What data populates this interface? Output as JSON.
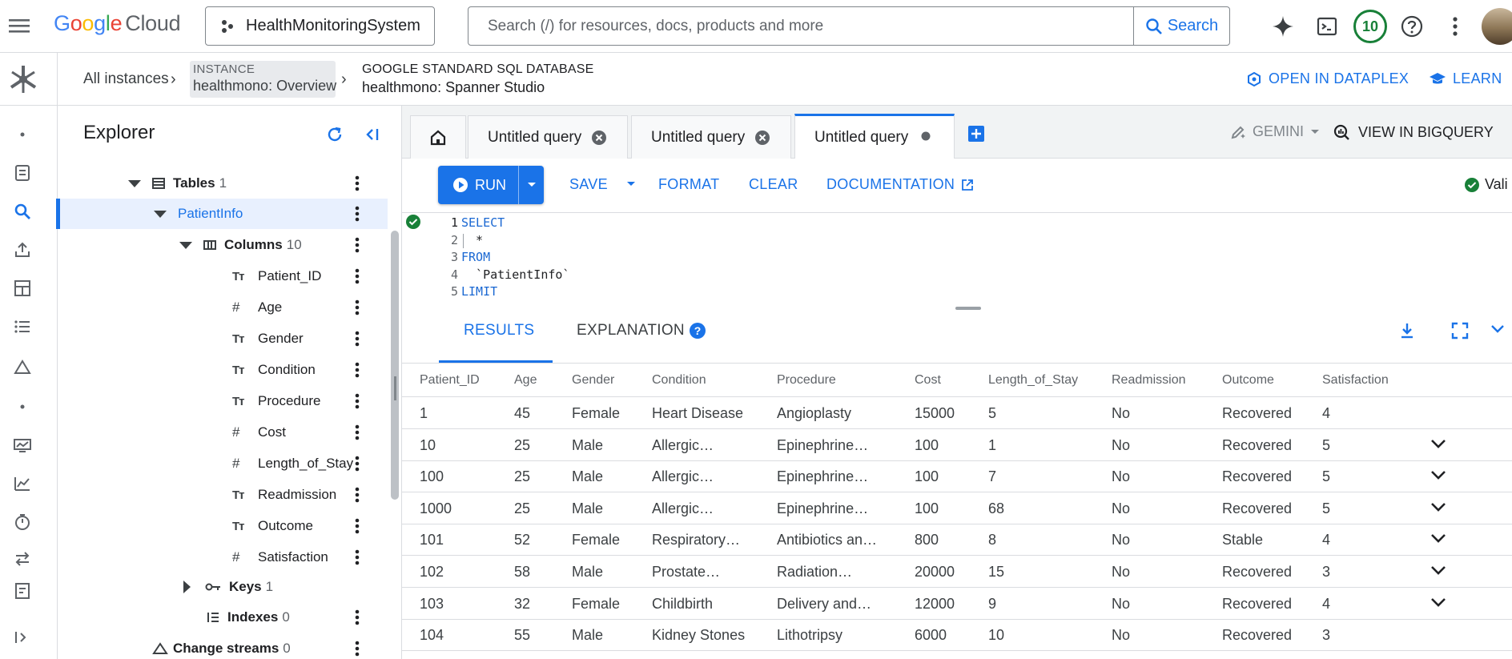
{
  "header": {
    "logo_google": "Google",
    "logo_cloud": "Cloud",
    "project": "HealthMonitoringSystem",
    "search_placeholder": "Search (/) for resources, docs, products and more",
    "search_button": "Search",
    "notification_count": "10"
  },
  "breadcrumb": {
    "all_instances": "All instances",
    "instance_label": "INSTANCE",
    "instance_name": "healthmono: Overview",
    "db_type": "GOOGLE STANDARD SQL DATABASE",
    "db_name": "healthmono: Spanner Studio",
    "open_dataplex": "OPEN IN DATAPLEX",
    "learn": "LEARN"
  },
  "explorer": {
    "title": "Explorer",
    "tables_label": "Tables",
    "tables_count": "1",
    "table_name": "PatientInfo",
    "columns_label": "Columns",
    "columns_count": "10",
    "columns": [
      {
        "name": "Patient_ID",
        "type": "string"
      },
      {
        "name": "Age",
        "type": "number"
      },
      {
        "name": "Gender",
        "type": "string"
      },
      {
        "name": "Condition",
        "type": "string"
      },
      {
        "name": "Procedure",
        "type": "string"
      },
      {
        "name": "Cost",
        "type": "number"
      },
      {
        "name": "Length_of_Stay",
        "type": "number"
      },
      {
        "name": "Readmission",
        "type": "string"
      },
      {
        "name": "Outcome",
        "type": "string"
      },
      {
        "name": "Satisfaction",
        "type": "number"
      }
    ],
    "keys_label": "Keys",
    "keys_count": "1",
    "indexes_label": "Indexes",
    "indexes_count": "0",
    "change_streams_label": "Change streams",
    "change_streams_count": "0"
  },
  "query_tabs": [
    {
      "label": "Untitled query",
      "state": "closable"
    },
    {
      "label": "Untitled query",
      "state": "closable"
    },
    {
      "label": "Untitled query",
      "state": "unsaved",
      "active": true
    }
  ],
  "gemini_label": "GEMINI",
  "view_in_bigquery": "VIEW IN BIGQUERY",
  "toolbar": {
    "run": "RUN",
    "save": "SAVE",
    "format": "FORMAT",
    "clear": "CLEAR",
    "documentation": "DOCUMENTATION",
    "valid": "Vali"
  },
  "editor": {
    "lines": [
      {
        "num": "1",
        "text": "SELECT",
        "keyword": true
      },
      {
        "num": "2",
        "text": "  *",
        "keyword": false
      },
      {
        "num": "3",
        "text": "FROM",
        "keyword": true
      },
      {
        "num": "4",
        "text": "  `PatientInfo`",
        "keyword": false
      },
      {
        "num": "5",
        "text": "LIMIT",
        "keyword": true
      }
    ]
  },
  "results": {
    "tab_results": "RESULTS",
    "tab_explanation": "EXPLANATION",
    "columns": [
      "Patient_ID",
      "Age",
      "Gender",
      "Condition",
      "Procedure",
      "Cost",
      "Length_of_Stay",
      "Readmission",
      "Outcome",
      "Satisfaction"
    ],
    "rows": [
      {
        "cells": [
          "1",
          "45",
          "Female",
          "Heart Disease",
          "Angioplasty",
          "15000",
          "5",
          "No",
          "Recovered",
          "4"
        ],
        "expandable": false
      },
      {
        "cells": [
          "10",
          "25",
          "Male",
          "Allergic…",
          "Epinephrine…",
          "100",
          "1",
          "No",
          "Recovered",
          "5"
        ],
        "expandable": true
      },
      {
        "cells": [
          "100",
          "25",
          "Male",
          "Allergic…",
          "Epinephrine…",
          "100",
          "7",
          "No",
          "Recovered",
          "5"
        ],
        "expandable": true
      },
      {
        "cells": [
          "1000",
          "25",
          "Male",
          "Allergic…",
          "Epinephrine…",
          "100",
          "68",
          "No",
          "Recovered",
          "5"
        ],
        "expandable": true
      },
      {
        "cells": [
          "101",
          "52",
          "Female",
          "Respiratory…",
          "Antibiotics an…",
          "800",
          "8",
          "No",
          "Stable",
          "4"
        ],
        "expandable": true
      },
      {
        "cells": [
          "102",
          "58",
          "Male",
          "Prostate…",
          "Radiation…",
          "20000",
          "15",
          "No",
          "Recovered",
          "3"
        ],
        "expandable": true
      },
      {
        "cells": [
          "103",
          "32",
          "Female",
          "Childbirth",
          "Delivery and…",
          "12000",
          "9",
          "No",
          "Recovered",
          "4"
        ],
        "expandable": true
      },
      {
        "cells": [
          "104",
          "55",
          "Male",
          "Kidney Stones",
          "Lithotripsy",
          "6000",
          "10",
          "No",
          "Recovered",
          "3"
        ],
        "expandable": false
      }
    ]
  },
  "colors": {
    "accent": "#1a73e8",
    "success": "#188038",
    "selected_bg": "#e8f0fe"
  }
}
